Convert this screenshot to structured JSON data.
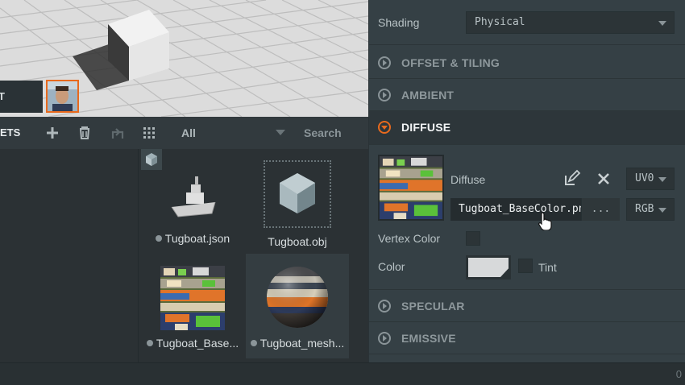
{
  "viewport": {
    "label": "T"
  },
  "assets": {
    "title": "ETS",
    "filter": "All",
    "search_label": "Search",
    "items": [
      {
        "name": "Tugboat.json",
        "type": "json",
        "status_dot": true
      },
      {
        "name": "Tugboat.obj",
        "type": "model",
        "status_dot": false
      },
      {
        "name": "Tugboat_Base...",
        "type": "texture",
        "status_dot": true
      },
      {
        "name": "Tugboat_mesh...",
        "type": "material",
        "status_dot": true
      }
    ]
  },
  "inspector": {
    "shading": {
      "label": "Shading",
      "value": "Physical"
    },
    "sections": [
      {
        "title": "OFFSET & TILING",
        "open": false
      },
      {
        "title": "AMBIENT",
        "open": false
      },
      {
        "title": "DIFFUSE",
        "open": true
      },
      {
        "title": "SPECULAR",
        "open": false
      },
      {
        "title": "EMISSIVE",
        "open": false
      }
    ],
    "diffuse": {
      "map_label": "Diffuse",
      "uv_value": "UV0",
      "texture_value": "Tugboat_BaseColor.png",
      "browse_label": "...",
      "channel_value": "RGB",
      "vertex_color_label": "Vertex Color",
      "color_label": "Color",
      "color_value": "#d7d9da",
      "tint_label": "Tint"
    }
  },
  "statusbar": {
    "count": "0"
  },
  "colors": {
    "accent": "#e86a1e",
    "panel": "#354045",
    "background": "#2b3134"
  }
}
